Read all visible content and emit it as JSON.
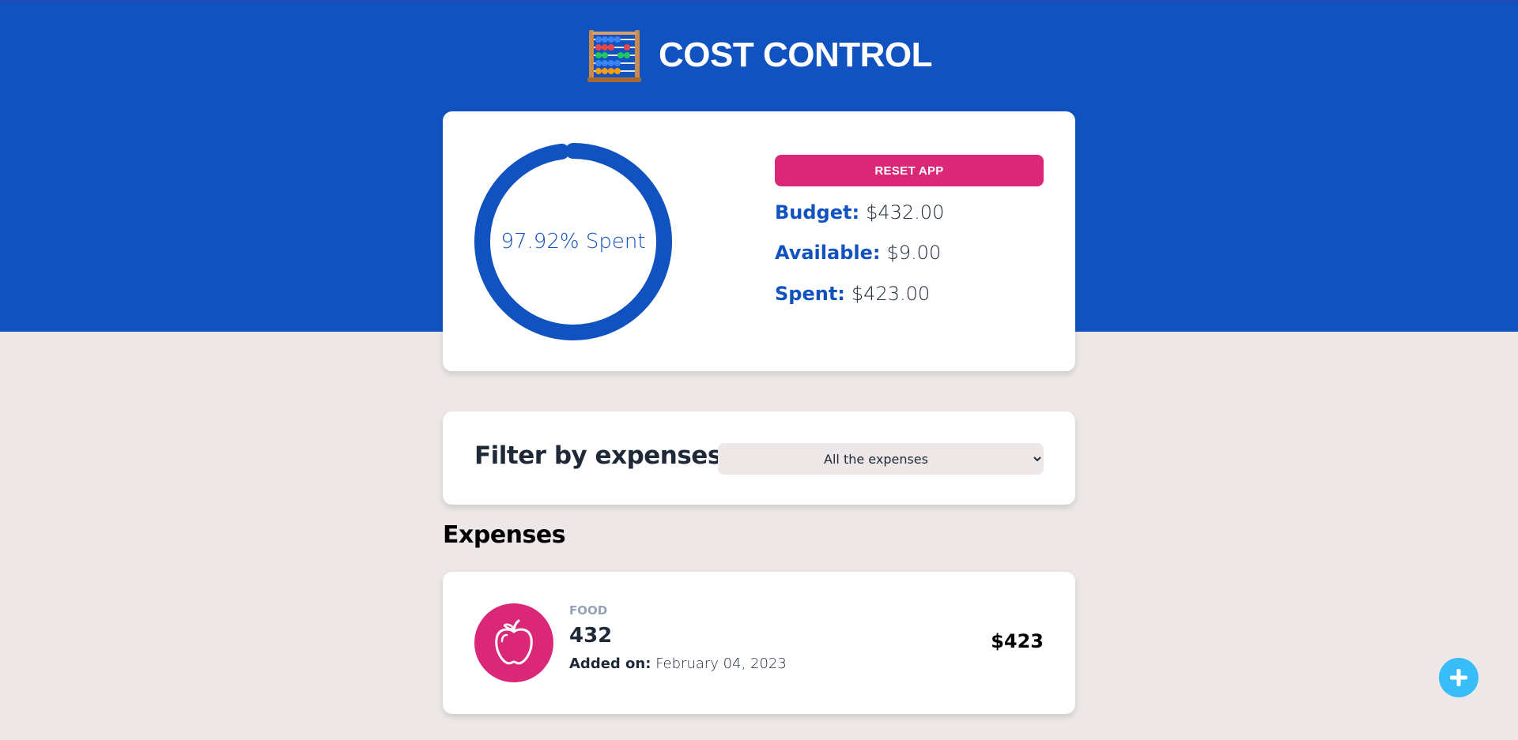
{
  "header": {
    "title": "COST CONTROL",
    "logo_icon": "abacus-icon"
  },
  "summary": {
    "spent_percent": 97.92,
    "donut_label": "97.92% Spent",
    "reset_label": "RESET APP",
    "budget_label": "Budget:",
    "budget_value": "$432.00",
    "available_label": "Available:",
    "available_value": "$9.00",
    "spent_label": "Spent:",
    "spent_value": "$423.00",
    "colors": {
      "accent": "#1052c0",
      "reset": "#db2777",
      "track": "#f5f5f5"
    }
  },
  "filter": {
    "label": "Filter by expenses",
    "selected": "All the expenses"
  },
  "expenses": {
    "heading": "Expenses",
    "items": [
      {
        "category": "FOOD",
        "name": "432",
        "date_label": "Added on:",
        "date_value": "February 04, 2023",
        "amount": "$423",
        "icon": "apple-icon",
        "icon_color": "#db2777"
      }
    ]
  },
  "fab": {
    "icon": "plus-icon",
    "color": "#38bdf8"
  }
}
